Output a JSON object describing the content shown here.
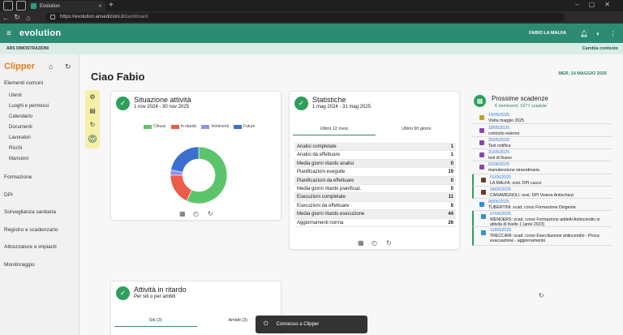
{
  "browser": {
    "tab_title": "Evolution",
    "url_host": "https://evolution.ansedizioni.it",
    "url_path": "/dashboard"
  },
  "app": {
    "brand": "evolution",
    "user": "FABIO LA MALFA",
    "context_left": "ARS DIMOSTRAZIONI",
    "context_right": "Cambia contesto"
  },
  "sidebar": {
    "title": "Clipper",
    "sections": [
      {
        "label": "Elementi comuni",
        "items": [
          "Utenti",
          "Luoghi e permessi",
          "Calendario",
          "Documenti",
          "Lavoratori",
          "Rischi",
          "Mansioni"
        ]
      },
      {
        "label": "Formazione",
        "items": []
      },
      {
        "label": "DPI",
        "items": []
      },
      {
        "label": "Sorveglianza sanitaria",
        "items": []
      },
      {
        "label": "Registro e scadenzario",
        "items": []
      },
      {
        "label": "Attrezzature e impianti",
        "items": []
      },
      {
        "label": "Monitoraggio",
        "items": []
      }
    ]
  },
  "main": {
    "greeting": "Ciao Fabio",
    "date": "MER, 14 MAGGIO 2025"
  },
  "activity_card": {
    "title": "Situazione attività",
    "range": "1 nov 2024 - 30 nov 2025",
    "legend": [
      {
        "label": "Chiuse",
        "color": "#5cc56b"
      },
      {
        "label": "In ritardo",
        "color": "#ec5b4c"
      },
      {
        "label": "Imminenti",
        "color": "#8f95ea"
      },
      {
        "label": "Future",
        "color": "#3d6fd0"
      }
    ]
  },
  "chart_data": {
    "type": "pie",
    "donut": true,
    "categories": [
      "Chiuse",
      "In ritardo",
      "Imminenti",
      "Future"
    ],
    "values": [
      57,
      18,
      3,
      22
    ],
    "colors": [
      "#5cc56b",
      "#ec5b4c",
      "#8f95ea",
      "#3d6fd0"
    ]
  },
  "stats_card": {
    "title": "Statistiche",
    "range": "1 mag 2024 - 31 mag 2025",
    "tabs": [
      "Ultimi 12 mesi",
      "Ultimi 90 giorni"
    ],
    "rows": [
      {
        "label": "Analisi completate",
        "value": "1"
      },
      {
        "label": "Analisi da effettuare",
        "value": "1"
      },
      {
        "label": "Media giorni ritardo analisi",
        "value": "0"
      },
      {
        "label": "Pianificazioni eseguite",
        "value": "19"
      },
      {
        "label": "Pianificazioni da effettuare",
        "value": "0"
      },
      {
        "label": "Media giorni ritardo pianificaz.",
        "value": "0"
      },
      {
        "label": "Esecuzioni completate",
        "value": "11"
      },
      {
        "label": "Esecuzioni da effettuare",
        "value": "8"
      },
      {
        "label": "Media giorni ritardo esecuzione",
        "value": "44"
      },
      {
        "label": "Aggiornamenti norma",
        "value": "26"
      }
    ]
  },
  "late_card": {
    "title": "Attività in ritardo",
    "subtitle": "Per siti o per ambiti",
    "tabs": [
      "Siti (3)",
      "Ambiti (3)"
    ]
  },
  "deadlines": {
    "title": "Prossime scadenze",
    "subtitle": "6 imminenti, 1677 scadute",
    "items": [
      {
        "date": "14/05/2025",
        "text": "Visita maggio 2025",
        "color": "#c9a21c",
        "bar": false
      },
      {
        "date": "18/05/2025",
        "text": "controllo esterno",
        "color": "#8e44ad",
        "bar": false
      },
      {
        "date": "25/05/2025",
        "text": "Test notifica",
        "color": "#8e44ad",
        "bar": false
      },
      {
        "date": "31/05/2025",
        "text": "test di flusso",
        "color": "#8e44ad",
        "bar": false
      },
      {
        "date": "01/06/2025",
        "text": "manutenzione straordinaria",
        "color": "#8e44ad",
        "bar": false
      },
      {
        "date": "01/06/2025",
        "text": "LA MALFA: sost. DPI casco",
        "color": "#6d3b1f",
        "bar": true
      },
      {
        "date": "04/06/2025",
        "text": "CARAMIGNOLI: sost. DPI Visiera Antischizzi",
        "color": "#6d3b1f",
        "bar": true
      },
      {
        "date": "06/06/2025",
        "text": "TUBERTINI: scad. corso Formazione Dirigente",
        "color": "#2f8fd8",
        "bar": false
      },
      {
        "date": "07/06/2025",
        "text": "WENDERS: scad. corso Formazione addetti Antincendio in attività di livello 1 (ante 2023)",
        "color": "#2f8fd8",
        "bar": true
      },
      {
        "date": "12/06/2025",
        "text": "TRECCANI: scad. corso Esercitazione antincendio - Prova evacuazione - aggiornamento",
        "color": "#2f8fd8",
        "bar": true
      }
    ]
  },
  "toast": {
    "text": "Connesso a Clipper"
  }
}
